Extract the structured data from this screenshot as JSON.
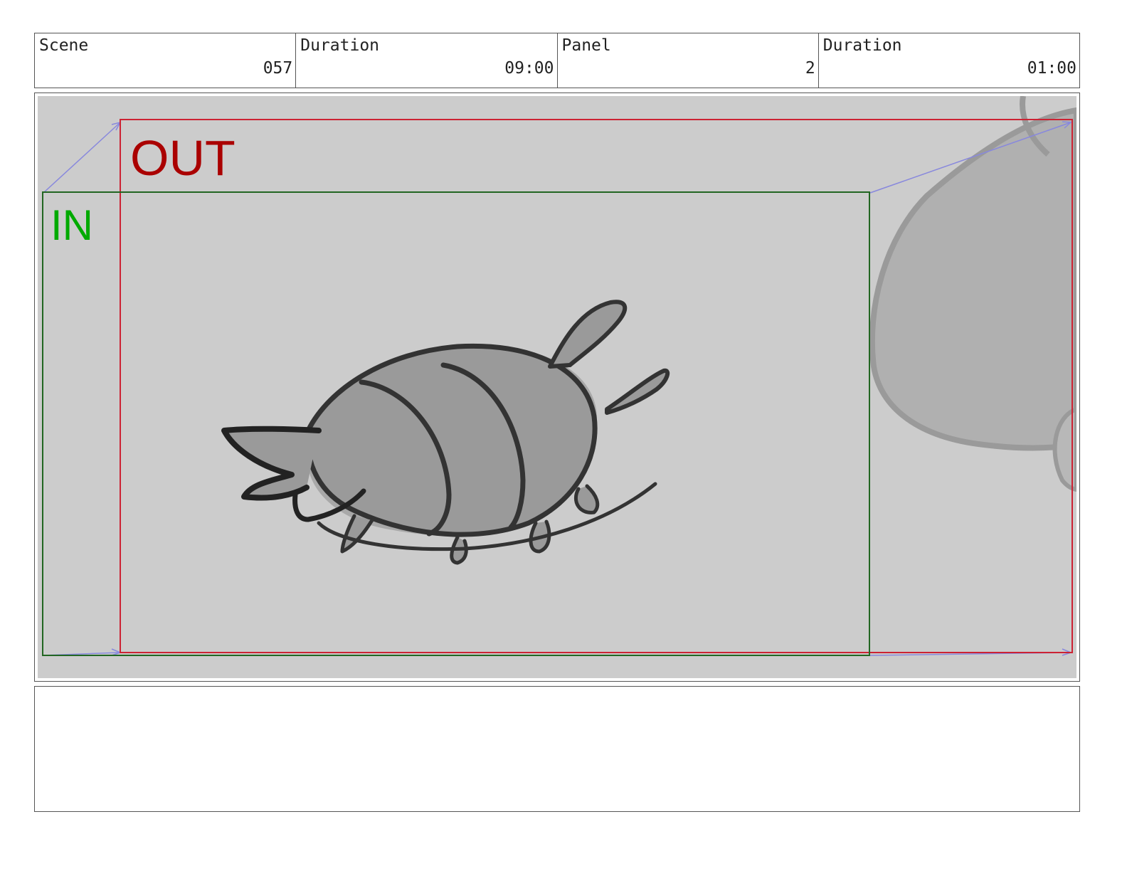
{
  "header": {
    "scene_label": "Scene",
    "scene_value": "057",
    "duration_label": "Duration",
    "duration_value": "09:00",
    "panel_label": "Panel",
    "panel_value": "2",
    "panel_duration_label": "Duration",
    "panel_duration_value": "01:00"
  },
  "frame": {
    "out_label": "OUT",
    "in_label": "IN",
    "out_color": "#aa0000",
    "in_color": "#00aa00",
    "background": "#cccccc"
  },
  "notes": {
    "text": ""
  }
}
